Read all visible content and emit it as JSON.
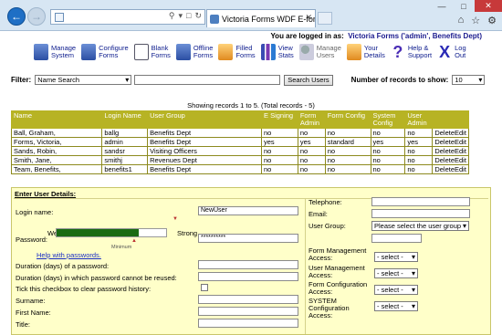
{
  "browser": {
    "tab_title": "Victoria Forms WDF E-form...",
    "win_controls": [
      "—",
      "□",
      "✕"
    ],
    "tool_icons": [
      "⌂",
      "☆",
      "⚙"
    ]
  },
  "header": {
    "logged_in_prefix": "You are logged in as:",
    "logged_in_user": "Victoria Forms ('admin', Benefits Dept)"
  },
  "toolbar": [
    {
      "line1": "Manage",
      "line2": "System",
      "icon": "manage-system-icon",
      "cls": "ico-blue"
    },
    {
      "line1": "Configure",
      "line2": "Forms",
      "icon": "configure-forms-icon",
      "cls": "ico-blue"
    },
    {
      "line1": "Blank",
      "line2": "Forms",
      "icon": "blank-forms-icon",
      "cls": "ico-doc"
    },
    {
      "line1": "Offline",
      "line2": "Forms",
      "icon": "offline-forms-icon",
      "cls": "ico-blue"
    },
    {
      "line1": "Filled",
      "line2": "Forms",
      "icon": "filled-forms-icon",
      "cls": "ico-orange"
    },
    {
      "line1": "View",
      "line2": "Stats",
      "icon": "view-stats-icon",
      "cls": "ico-chart"
    },
    {
      "line1": "Manage",
      "line2": "Users",
      "icon": "manage-users-icon",
      "cls": "ico-users",
      "gray": true
    },
    {
      "line1": "Your",
      "line2": "Details",
      "icon": "your-details-icon",
      "cls": "ico-orange"
    },
    {
      "line1": "Help &",
      "line2": "Support",
      "icon": "help-icon",
      "cls": "ico-help",
      "glyph": "?"
    },
    {
      "line1": "Log",
      "line2": "Out",
      "icon": "logout-icon",
      "cls": "ico-logout",
      "glyph": "X"
    }
  ],
  "filter": {
    "label": "Filter:",
    "field": "Name Search",
    "query": "",
    "search_button": "Search Users",
    "records_label": "Number of records to show:",
    "records_value": "10"
  },
  "showing": "Showing records 1 to 5. (Total records - 5)",
  "table": {
    "headers": [
      "Name",
      "Login Name",
      "User Group",
      "E Signing",
      "Form Admin",
      "Form Config",
      "System Config",
      "User Admin",
      ""
    ],
    "rows": [
      [
        "Ball, Graham,",
        "ballg",
        "Benefits Dept",
        "no",
        "no",
        "no",
        "no",
        "no"
      ],
      [
        "Forms, Victoria,",
        "admin",
        "Benefits Dept",
        "yes",
        "yes",
        "standard",
        "yes",
        "yes"
      ],
      [
        "Sands, Robin,",
        "sandsr",
        "Visiting Officers",
        "no",
        "no",
        "no",
        "no",
        "no"
      ],
      [
        "Smith, Jane,",
        "smithj",
        "Revenues Dept",
        "no",
        "no",
        "no",
        "no",
        "no"
      ],
      [
        "Team, Benefits,",
        "benefits1",
        "Benefits Dept",
        "no",
        "no",
        "no",
        "no",
        "no"
      ]
    ],
    "delete_label": "Delete",
    "edit_label": "Edit"
  },
  "details": {
    "heading": "Enter User Details:",
    "login_label": "Login name:",
    "login_value": "NewUser",
    "password_label": "Password:",
    "weak": "Weak",
    "strong": "Strong",
    "minimum": "Minimum",
    "password_value": "**********",
    "strength": 0.75,
    "help_link": "Help with passwords.",
    "duration_label": "Duration (days) of a password:",
    "duration_cannot_label": "Duration (days) in which password cannot be reused:",
    "clear_history_label": "Tick this checkbox to clear password history:",
    "surname_label": "Surname:",
    "firstname_label": "First Name:",
    "title_label": "Title:",
    "telephone_label": "Telephone:",
    "email_label": "Email:",
    "group_label": "User Group:",
    "group_placeholder": "Please select the user group",
    "form_mgmt_label": "Form Management Access:",
    "user_mgmt_label": "User Management Access:",
    "form_config_label": "Form Configuration Access:",
    "system_config_label": "SYSTEM Configuration Access:",
    "select_placeholder": "- select -"
  }
}
